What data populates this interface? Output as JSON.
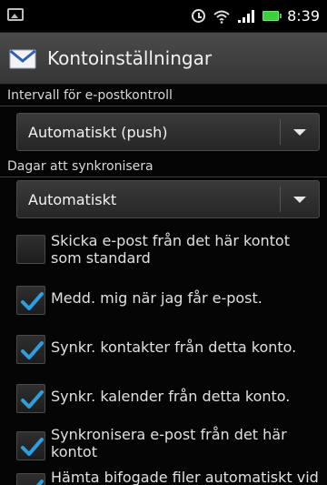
{
  "status_bar": {
    "time": "8:39"
  },
  "header": {
    "title": "Kontoinställningar"
  },
  "sections": {
    "interval_label": "Intervall för e-postkontroll",
    "interval_value": "Automatiskt (push)",
    "sync_days_label": "Dagar att synkronisera",
    "sync_days_value": "Automatiskt"
  },
  "checkboxes": [
    {
      "label": "Skicka e-post från det här kontot som standard",
      "checked": false
    },
    {
      "label": "Medd. mig när jag får e-post.",
      "checked": true
    },
    {
      "label": "Synkr. kontakter från detta konto.",
      "checked": true
    },
    {
      "label": "Synkr. kalender från detta konto.",
      "checked": true
    },
    {
      "label": "Synkronisera e-post från det här kontot",
      "checked": true
    },
    {
      "label": "Hämta bifogade filer automatiskt vid",
      "checked": true
    }
  ],
  "colors": {
    "check_accent": "#2b9fe0",
    "battery": "#3dd03d"
  }
}
